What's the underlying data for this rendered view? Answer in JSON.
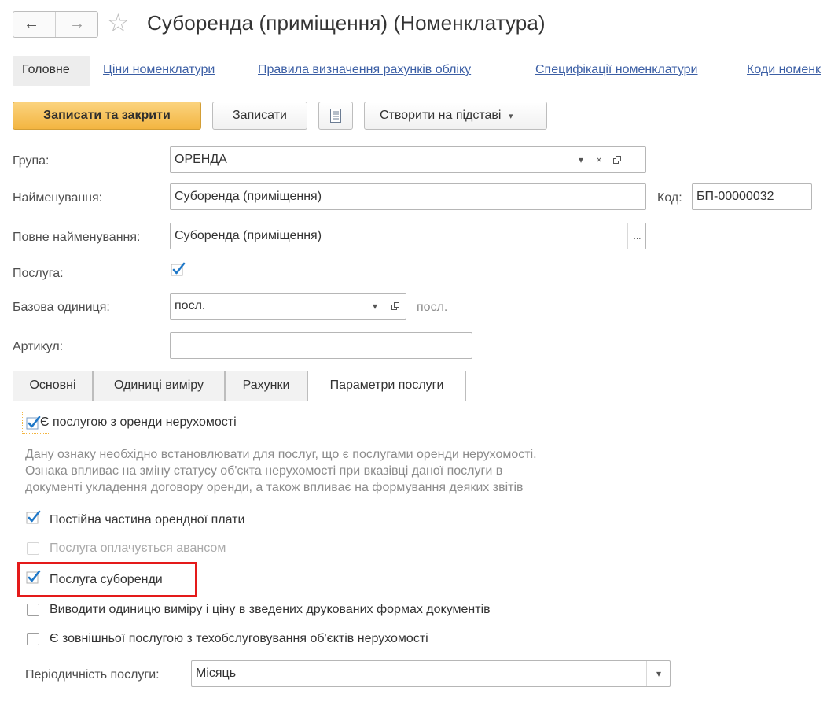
{
  "window": {
    "title": "Суборенда (приміщення) (Номенклатура)",
    "back_icon": "←",
    "forward_icon": "→",
    "favorite_icon": "☆"
  },
  "nav": {
    "items": [
      {
        "label": "Головне",
        "active": true
      },
      {
        "label": "Ціни номенклатури"
      },
      {
        "label": "Правила визначення рахунків обліку"
      },
      {
        "label": "Специфікації номенклатури"
      },
      {
        "label": "Коди номенк"
      }
    ]
  },
  "toolbar": {
    "save_close": "Записати та закрити",
    "save": "Записати",
    "create_based": "Створити на підставі",
    "dropdown_caret": "▾"
  },
  "form": {
    "group_label": "Група:",
    "group_value": "ОРЕНДА",
    "name_label": "Найменування:",
    "name_value": "Суборенда (приміщення)",
    "code_label": "Код:",
    "code_value": "БП-00000032",
    "fullname_label": "Повне найменування:",
    "fullname_value": "Суборенда (приміщення)",
    "fullname_btn": "...",
    "service_label": "Послуга:",
    "service_checked": true,
    "unit_label": "Базова одиниця:",
    "unit_value": "посл.",
    "unit_hint": "посл.",
    "article_label": "Артикул:",
    "article_value": ""
  },
  "tabs": [
    {
      "label": "Основні"
    },
    {
      "label": "Одиниці виміру"
    },
    {
      "label": "Рахунки"
    },
    {
      "label": "Параметри послуги",
      "active": true
    }
  ],
  "params": {
    "real_estate_rent": {
      "label": "Є послугою з оренди нерухомості",
      "checked": true
    },
    "hint_lines": [
      "Дану ознаку необхідно встановлювати для послуг, що є послугами оренди нерухомості.",
      "Ознака впливає на зміну статусу об'єкта нерухомості при вказівці даної послуги в",
      "документі укладення договору оренди, а також впливає на формування деяких звітів"
    ],
    "fixed_part": {
      "label": "Постійна частина орендної плати",
      "checked": true
    },
    "prepaid": {
      "label": "Послуга оплачується авансом",
      "checked": false,
      "disabled": true
    },
    "sublease": {
      "label": "Послуга суборенди",
      "checked": true
    },
    "print_unit": {
      "label": "Виводити одиницю виміру і ціну в зведених друкованих формах документів",
      "checked": false
    },
    "external_maintenance": {
      "label": "Є зовнішньої послугою з техобслуговування об'єктів нерухомості",
      "checked": false
    },
    "periodicity_label": "Періодичність послуги:",
    "periodicity_value": "Місяць"
  },
  "colors": {
    "accent_button": "#f3b541",
    "link": "#3c5fa5",
    "check": "#1f78c8",
    "highlight": "#e41a1a"
  }
}
